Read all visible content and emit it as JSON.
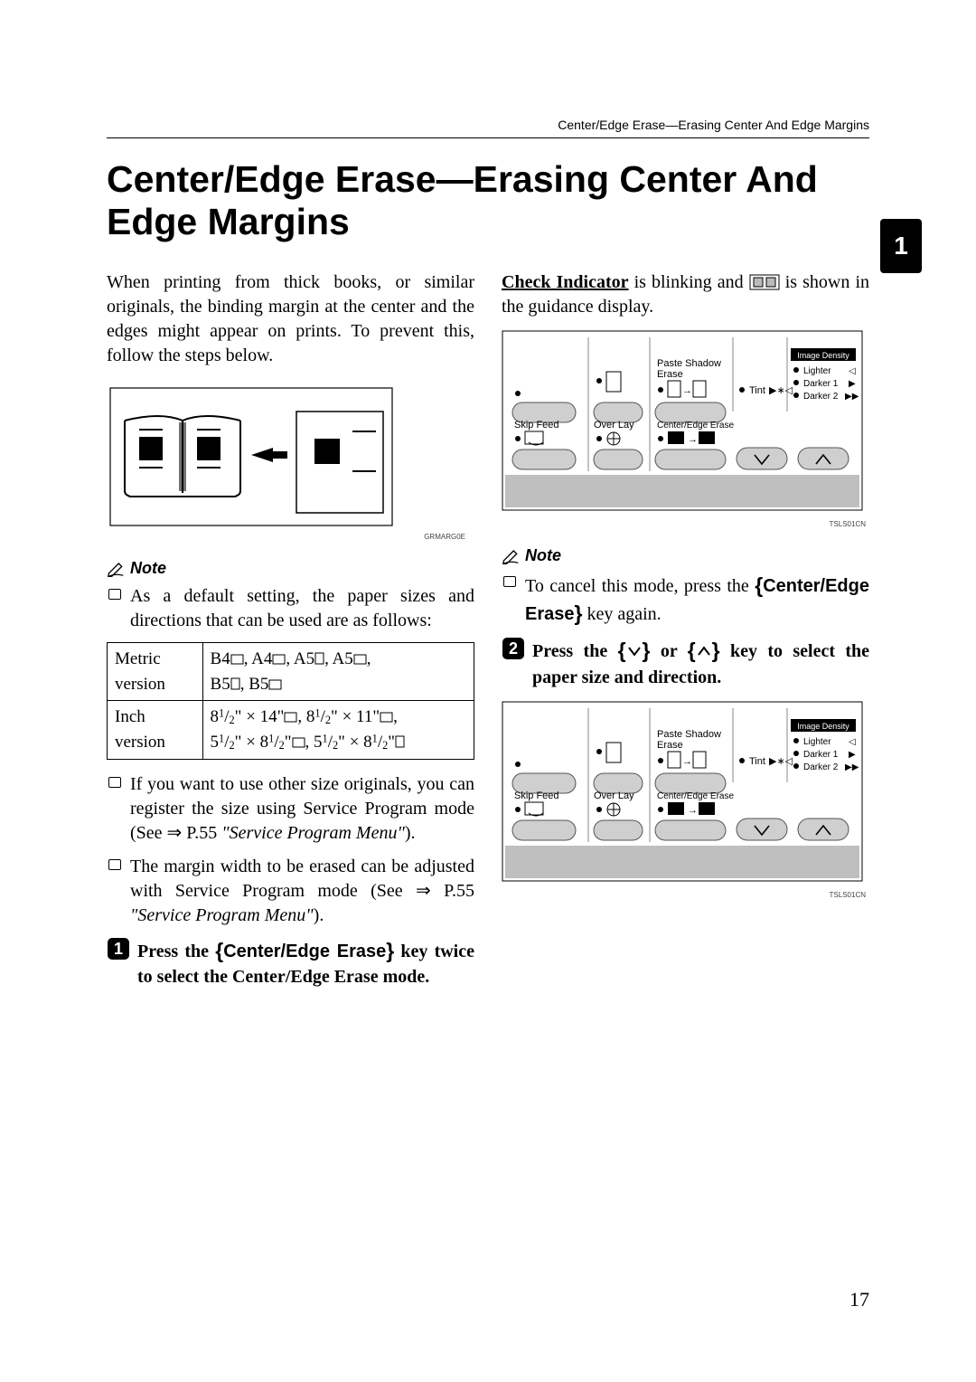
{
  "running_head": "Center/Edge Erase—Erasing Center And Edge Margins",
  "title": "Center/Edge Erase—Erasing Center And Edge Margins",
  "side_tab": "1",
  "page_number": "17",
  "left": {
    "intro": "When printing from thick books, or similar originals, the binding margin at the center and the edges might appear on prints. To prevent this, follow the steps below.",
    "illus_caption": "GRMARG0E",
    "note_label": "Note",
    "note1": "As a default setting, the paper sizes and directions that can be used are as follows:",
    "table": {
      "r1c1a": "Metric",
      "r1c1b": "version",
      "r2c1a": "Inch",
      "r2c1b": "version"
    },
    "note2_a": "If you want to use other size originals, you can register the size using Service Program mode (See ⇒ P.55 ",
    "note2_b": "\"Service Program Menu\"",
    "note2_c": ").",
    "note3_a": "The margin width to be erased can be adjusted with Service Program mode (See ⇒ P.55 ",
    "note3_b": "\"Service Program Menu\"",
    "note3_c": ").",
    "step1_a": "Press the ",
    "step1_key": "Center/Edge Erase",
    "step1_b": " key twice to select the Center/Edge Erase mode."
  },
  "right": {
    "p1_a": "Check Indicator",
    "p1_b": " is blinking and ",
    "p1_c": " is shown in the guidance display.",
    "note_label": "Note",
    "note1_a": "To cancel this mode, press the ",
    "note1_key": "Center/Edge Erase",
    "note1_b": " key again.",
    "step2_a": "Press the ",
    "step2_b": " or ",
    "step2_c": " key to select the paper size and direction.",
    "panel_caption": "TSLS01CN",
    "panel": {
      "paste_shadow": "Paste Shadow",
      "erase": "Erase",
      "image_density": "Image Density",
      "lighter": "Lighter",
      "darker1": "Darker 1",
      "darker2": "Darker 2",
      "tint": "Tint",
      "skip_feed": "Skip Feed",
      "over_lay": "Over Lay",
      "center_edge": "Center/Edge Erase"
    }
  }
}
